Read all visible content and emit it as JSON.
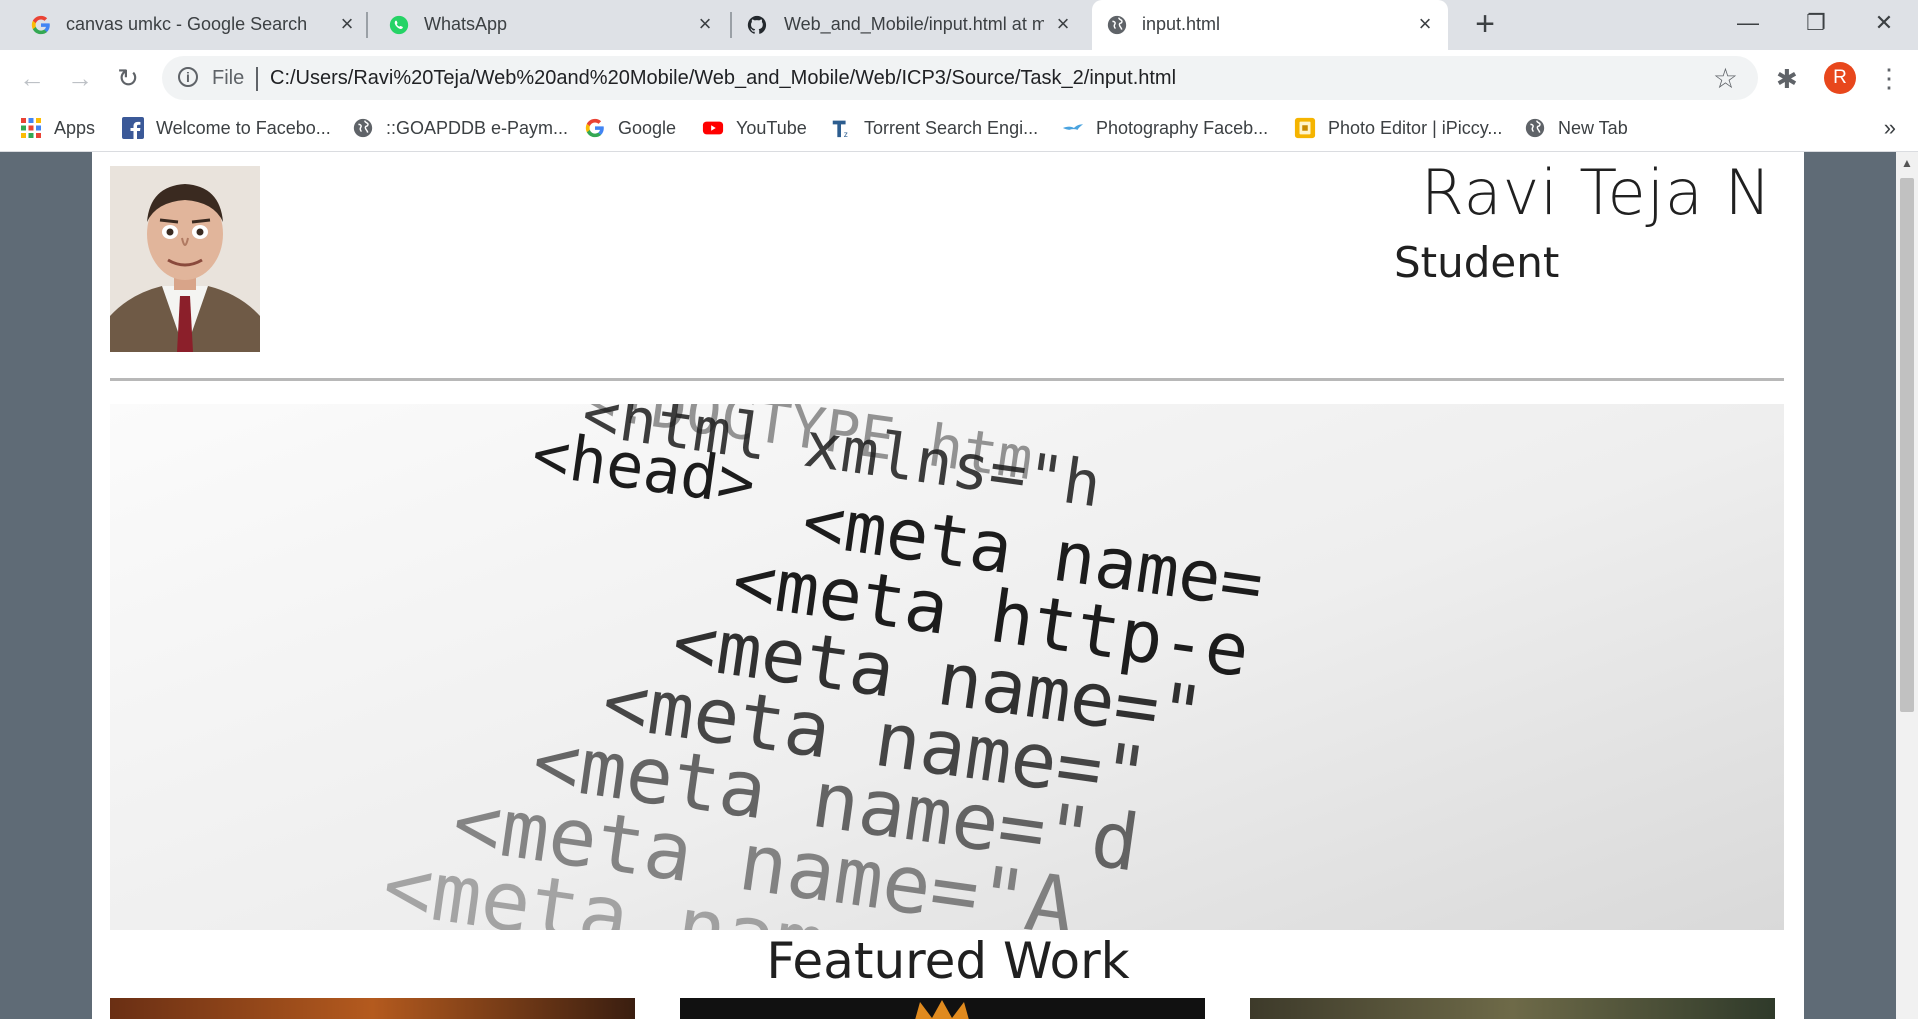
{
  "browser": {
    "tabs": [
      {
        "title": "canvas umkc - Google Search",
        "icon": "google-icon"
      },
      {
        "title": "WhatsApp",
        "icon": "whatsapp-icon"
      },
      {
        "title": "Web_and_Mobile/input.html at m",
        "icon": "github-icon"
      },
      {
        "title": "input.html",
        "icon": "globe-icon"
      }
    ],
    "new_tab": "+",
    "window_controls": {
      "minimize": "—",
      "restore": "❐",
      "close": "✕"
    },
    "toolbar": {
      "back": "←",
      "forward": "→",
      "reload": "↻",
      "scheme": "File",
      "url": "C:/Users/Ravi%20Teja/Web%20and%20Mobile/Web_and_Mobile/Web/ICP3/Source/Task_2/input.html",
      "bookmark_star": "☆",
      "extensions": "✱",
      "avatar_initial": "R",
      "menu": "⋮"
    },
    "bookmarks": [
      {
        "label": "Apps",
        "icon": "apps-grid-icon"
      },
      {
        "label": "Welcome to Facebo...",
        "icon": "facebook-icon"
      },
      {
        "label": "::GOAPDDB e-Paym...",
        "icon": "globe-icon"
      },
      {
        "label": "Google",
        "icon": "google-icon"
      },
      {
        "label": "YouTube",
        "icon": "youtube-icon"
      },
      {
        "label": "Torrent Search Engi...",
        "icon": "torrentz-icon"
      },
      {
        "label": "Photography Faceb...",
        "icon": "bird-icon"
      },
      {
        "label": "Photo Editor | iPiccy...",
        "icon": "ipiccy-icon"
      },
      {
        "label": "New Tab",
        "icon": "globe-icon"
      }
    ],
    "bookmarks_more": "»"
  },
  "page": {
    "name": "Ravi Teja N",
    "role": "Student",
    "featured_heading": "Featured Work",
    "hero_code_lines": [
      "<!DOCTYPE htm",
      "<html xmlns=\"h",
      "<head>",
      "<meta name=",
      "<meta http-e",
      "<meta name=\"",
      "<meta name=\"",
      "<meta name=\"d",
      "<meta name=\"A",
      "<meta name"
    ]
  },
  "colors": {
    "tab_strip": "#dee1e6",
    "page_bg": "#5f6b76",
    "avatar": "#e8471c",
    "text": "#202020"
  }
}
